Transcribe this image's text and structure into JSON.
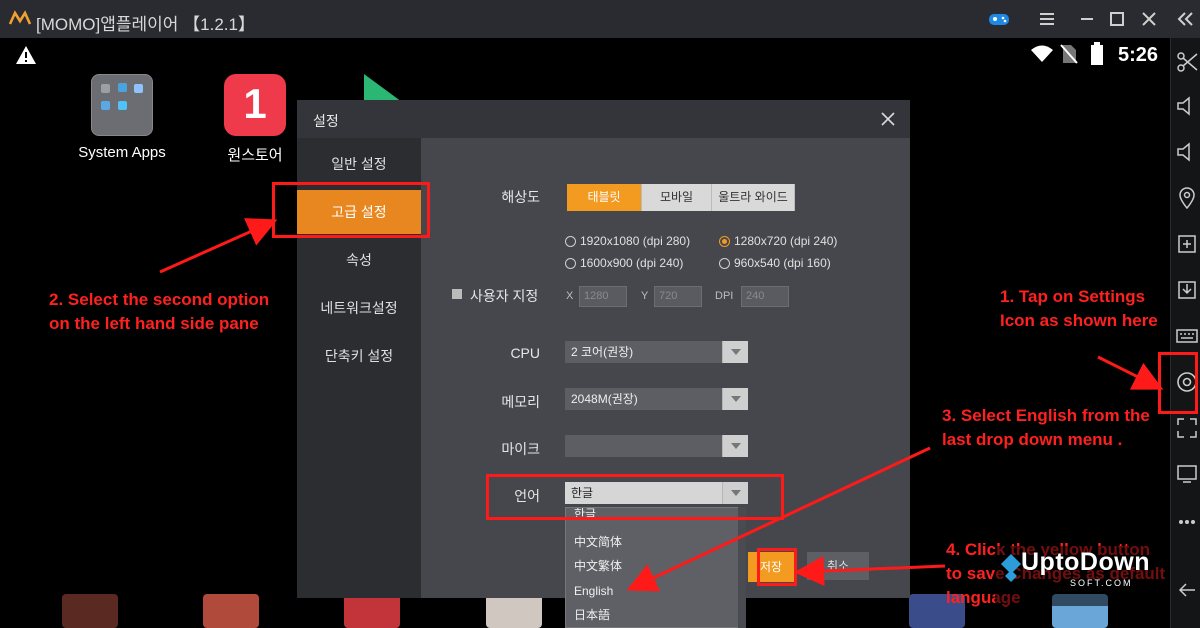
{
  "window": {
    "title": "[MOMO]앱플레이어 【1.2.1】",
    "time": "5:26"
  },
  "desktop": {
    "apps": [
      {
        "label": "System Apps"
      },
      {
        "label": "원스토어"
      }
    ],
    "onestore_glyph": "1"
  },
  "dialog": {
    "title": "설정",
    "nav": [
      "일반 설정",
      "고급 설정",
      "속성",
      "네트워크설정",
      "단축키 설정"
    ],
    "resolution": {
      "label": "해상도",
      "modes": [
        "태블릿",
        "모바일",
        "울트라 와이드"
      ],
      "selected_mode": "태블릿",
      "options": [
        "1920x1080 (dpi 280)",
        "1280x720 (dpi 240)",
        "1600x900 (dpi 240)",
        "960x540 (dpi 160)"
      ],
      "selected_option": "1280x720 (dpi 240)"
    },
    "custom": {
      "label": "사용자 지정",
      "x_label": "X",
      "x_value": "1280",
      "y_label": "Y",
      "y_value": "720",
      "dpi_label": "DPI",
      "dpi_value": "240"
    },
    "cpu": {
      "label": "CPU",
      "value": "2 코어(권장)"
    },
    "memory": {
      "label": "메모리",
      "value": "2048M(권장)"
    },
    "mic": {
      "label": "마이크",
      "value": ""
    },
    "language": {
      "label": "언어",
      "value": "한글",
      "options": [
        "한글",
        "中文简体",
        "中文繁体",
        "English",
        "日本語"
      ]
    },
    "save_label": "저장",
    "cancel_label": "취소"
  },
  "annotations": {
    "step1": [
      "1. Tap on Settings",
      "Icon as shown here"
    ],
    "step2": [
      "2. Select the second option",
      "on the left hand side pane"
    ],
    "step3": [
      "3. Select English from the",
      "last drop down menu ."
    ],
    "step4": [
      "4. Click the yellow button",
      "to save Changes as default",
      "language"
    ]
  },
  "watermark": {
    "name": "UptoDown",
    "sub": "SOFT.COM"
  },
  "colors": {
    "accent": "#f39a20",
    "annotation": "#ff1a1a"
  }
}
